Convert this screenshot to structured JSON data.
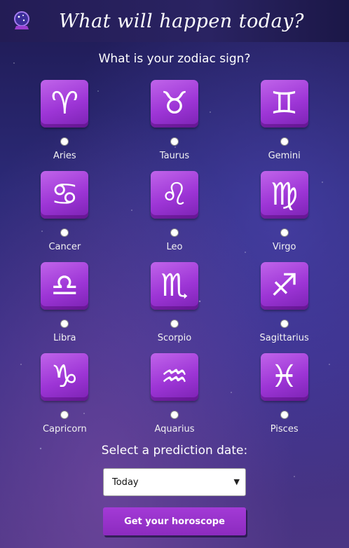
{
  "header": {
    "title": "What will happen today?",
    "logo_icon": "crystal-ball-icon"
  },
  "question": "What is your zodiac sign?",
  "signs": [
    {
      "name": "Aries",
      "glyph": "♈"
    },
    {
      "name": "Taurus",
      "glyph": "♉"
    },
    {
      "name": "Gemini",
      "glyph": "♊"
    },
    {
      "name": "Cancer",
      "glyph": "♋"
    },
    {
      "name": "Leo",
      "glyph": "♌"
    },
    {
      "name": "Virgo",
      "glyph": "♍"
    },
    {
      "name": "Libra",
      "glyph": "♎"
    },
    {
      "name": "Scorpio",
      "glyph": "♏"
    },
    {
      "name": "Sagittarius",
      "glyph": "♐"
    },
    {
      "name": "Capricorn",
      "glyph": "♑"
    },
    {
      "name": "Aquarius",
      "glyph": "♒"
    },
    {
      "name": "Pisces",
      "glyph": "♓"
    }
  ],
  "date": {
    "label": "Select a prediction date:",
    "selected": "Today"
  },
  "submit_label": "Get your horoscope",
  "colors": {
    "accent": "#9d35d6",
    "background": "#2c2a78"
  }
}
